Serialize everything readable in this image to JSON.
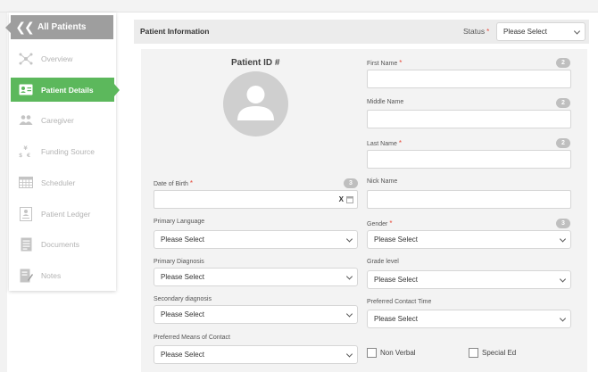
{
  "sidebar": {
    "header": {
      "label": "All Patients",
      "icon": "double-chevron-left-icon"
    },
    "items": [
      {
        "label": "Overview",
        "icon": "network-icon",
        "active": false
      },
      {
        "label": "Patient Details",
        "icon": "id-card-icon",
        "active": true
      },
      {
        "label": "Caregiver",
        "icon": "people-icon",
        "active": false
      },
      {
        "label": "Funding Source",
        "icon": "currency-icon",
        "active": false
      },
      {
        "label": "Scheduler",
        "icon": "calendar-icon",
        "active": false
      },
      {
        "label": "Patient Ledger",
        "icon": "ledger-icon",
        "active": false
      },
      {
        "label": "Documents",
        "icon": "document-icon",
        "active": false
      },
      {
        "label": "Notes",
        "icon": "notes-icon",
        "active": false
      }
    ]
  },
  "panel": {
    "title": "Patient Information",
    "status_label": "Status",
    "status_value": "Please Select"
  },
  "form": {
    "patient_id_label": "Patient ID #",
    "first_name": {
      "label": "First Name",
      "count": "2",
      "value": ""
    },
    "middle_name": {
      "label": "Middle Name",
      "count": "2",
      "value": ""
    },
    "last_name": {
      "label": "Last Name",
      "count": "2",
      "value": ""
    },
    "date_of_birth": {
      "label": "Date of Birth",
      "count": "3",
      "clear": "X",
      "value": ""
    },
    "nick_name": {
      "label": "Nick Name",
      "value": ""
    },
    "primary_language": {
      "label": "Primary Language",
      "value": "Please Select"
    },
    "gender": {
      "label": "Gender",
      "count": "3",
      "value": "Please Select"
    },
    "primary_diagnosis": {
      "label": "Primary Diagnosis",
      "value": "Please Select"
    },
    "grade_level": {
      "label": "Grade level",
      "value": "Please Select"
    },
    "secondary_diagnosis": {
      "label": "Secondary diagnosis",
      "value": "Please Select"
    },
    "preferred_contact_time": {
      "label": "Preferred Contact Time",
      "value": "Please Select"
    },
    "preferred_means_of_contact": {
      "label": "Preferred Means of Contact",
      "value": "Please Select"
    },
    "non_verbal": {
      "label": "Non Verbal",
      "checked": false
    },
    "special_ed": {
      "label": "Special Ed",
      "checked": false
    }
  },
  "colors": {
    "active": "#5cb85c",
    "header": "#9e9e9e",
    "required": "#e74c3c"
  }
}
